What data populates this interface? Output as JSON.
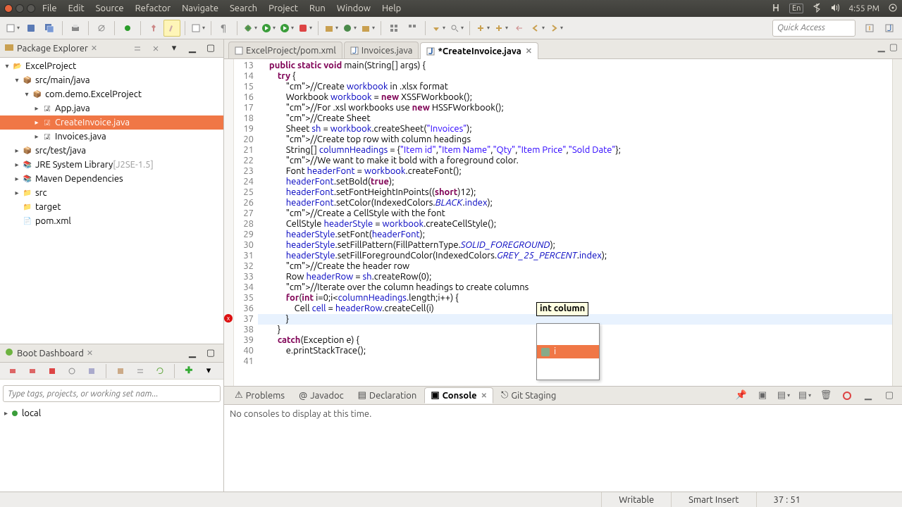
{
  "os": {
    "menu": [
      "File",
      "Edit",
      "Source",
      "Refactor",
      "Navigate",
      "Search",
      "Project",
      "Run",
      "Window",
      "Help"
    ],
    "lang": "En",
    "time": "4:55 PM"
  },
  "quick_access_placeholder": "Quick Access",
  "package_explorer": {
    "title": "Package Explorer",
    "tree": {
      "project": "ExcelProject",
      "src_main": "src/main/java",
      "pkg": "com.demo.ExcelProject",
      "files": [
        "App.java",
        "CreateInvoice.java",
        "Invoices.java"
      ],
      "src_test": "src/test/java",
      "jre": "JRE System Library",
      "jre_dec": " [J2SE-1.5]",
      "maven": "Maven Dependencies",
      "src": "src",
      "target": "target",
      "pom": "pom.xml"
    }
  },
  "boot": {
    "title": "Boot Dashboard",
    "filter_placeholder": "Type tags, projects, or working set nam...",
    "local": "local"
  },
  "editor_tabs": [
    {
      "label": "ExcelProject/pom.xml",
      "dirty": false
    },
    {
      "label": "Invoices.java",
      "dirty": false
    },
    {
      "label": "*CreateInvoice.java",
      "dirty": true,
      "active": true
    }
  ],
  "code": {
    "first_line": 13,
    "lines": [
      "",
      "    public static void main(String[] args) {",
      "        try {",
      "            //Create workbook in .xlsx format",
      "            Workbook workbook = new XSSFWorkbook();",
      "            //For .xsl workbooks use new HSSFWorkbook();",
      "            //Create Sheet",
      "            Sheet sh = workbook.createSheet(\"Invoices\");",
      "            //Create top row with column headings",
      "            String[] columnHeadings = {\"Item id\",\"Item Name\",\"Qty\",\"Item Price\",\"Sold Date\"};",
      "            //We want to make it bold with a foreground color.",
      "            Font headerFont = workbook.createFont();",
      "            headerFont.setBold(true);",
      "            headerFont.setFontHeightInPoints((short)12);",
      "            headerFont.setColor(IndexedColors.BLACK.index);",
      "            //Create a CellStyle with the font",
      "            CellStyle headerStyle = workbook.createCellStyle();",
      "            headerStyle.setFont(headerFont);",
      "            headerStyle.setFillPattern(FillPatternType.SOLID_FOREGROUND);",
      "            headerStyle.setFillForegroundColor(IndexedColors.GREY_25_PERCENT.index);",
      "            //Create the header row",
      "            Row headerRow = sh.createRow(0);",
      "            //Iterate over the column headings to create columns",
      "            for(int i=0;i<columnHeadings.length;i++) {",
      "                Cell cell = headerRow.createCell(i)",
      "            }",
      "        }",
      "        catch(Exception e) {",
      "            e.printStackTrace();"
    ],
    "param_hint": "int column",
    "autocomplete_item": "i",
    "error_line": 37
  },
  "bottom_tabs": [
    "Problems",
    "Javadoc",
    "Declaration",
    "Console",
    "Git Staging"
  ],
  "bottom_active": 3,
  "console_msg": "No consoles to display at this time.",
  "status": {
    "writable": "Writable",
    "insert": "Smart Insert",
    "pos": "37 : 51"
  }
}
